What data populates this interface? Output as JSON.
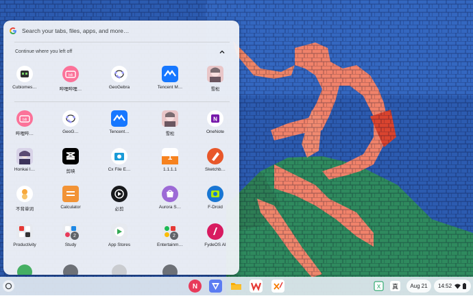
{
  "search": {
    "placeholder": "Search your tabs, files, apps, and more…"
  },
  "continue_section": {
    "label": "Continue where you left off"
  },
  "recent_apps": [
    {
      "label": "Cubiomes…",
      "icon": "cubiomes-icon"
    },
    {
      "label": "哔哩哔哩…",
      "icon": "bilibili-icon"
    },
    {
      "label": "GeoGebra",
      "icon": "geogebra-icon"
    },
    {
      "label": "Tencent M…",
      "icon": "tencent-meeting-icon"
    },
    {
      "label": "雪松",
      "icon": "xuesong-icon"
    }
  ],
  "apps": [
    {
      "label": "哔哩哔…",
      "icon": "bilibili-icon"
    },
    {
      "label": "GeoG…",
      "icon": "geogebra-icon"
    },
    {
      "label": "Tencent…",
      "icon": "tencent-meeting-icon"
    },
    {
      "label": "雪松",
      "icon": "xuesong-icon"
    },
    {
      "label": "OneNote",
      "icon": "onenote-icon"
    },
    {
      "label": "Honkai I…",
      "icon": "honkai-icon"
    },
    {
      "label": "剪映",
      "icon": "capcut-icon"
    },
    {
      "label": "Cx File E…",
      "icon": "cx-file-explorer-icon"
    },
    {
      "label": "1.1.1.1",
      "icon": "cloudflare-warp-icon"
    },
    {
      "label": "Sketchb…",
      "icon": "sketchbook-icon"
    },
    {
      "label": "不背单词",
      "icon": "bubeidanci-icon"
    },
    {
      "label": "Calculator",
      "icon": "calculator-icon"
    },
    {
      "label": "必剪",
      "icon": "bijian-icon"
    },
    {
      "label": "Aurora S…",
      "icon": "aurora-store-icon"
    },
    {
      "label": "F-Droid",
      "icon": "fdroid-icon"
    },
    {
      "label": "Productivity",
      "icon": "productivity-folder-icon"
    },
    {
      "label": "Study",
      "icon": "study-folder-icon",
      "badge": "2"
    },
    {
      "label": "App Stores",
      "icon": "app-stores-folder-icon"
    },
    {
      "label": "Entertainm…",
      "icon": "entertainment-folder-icon",
      "badge": "2"
    },
    {
      "label": "FydeOS AI",
      "icon": "fydeos-ai-icon"
    }
  ],
  "shelf": {
    "pinned": [
      "notion-icon",
      "vpn-icon",
      "files-icon",
      "wps-office-icon",
      "xodo-icon"
    ],
    "tray_left": [
      "sheets-icon",
      "ime-icon"
    ],
    "date": "Aug 21",
    "time": "14:52"
  },
  "colors": {
    "accent": "#1a73e8",
    "launcher_bg": "#f1f3f8",
    "shelf_bg": "#e1e8f0"
  }
}
